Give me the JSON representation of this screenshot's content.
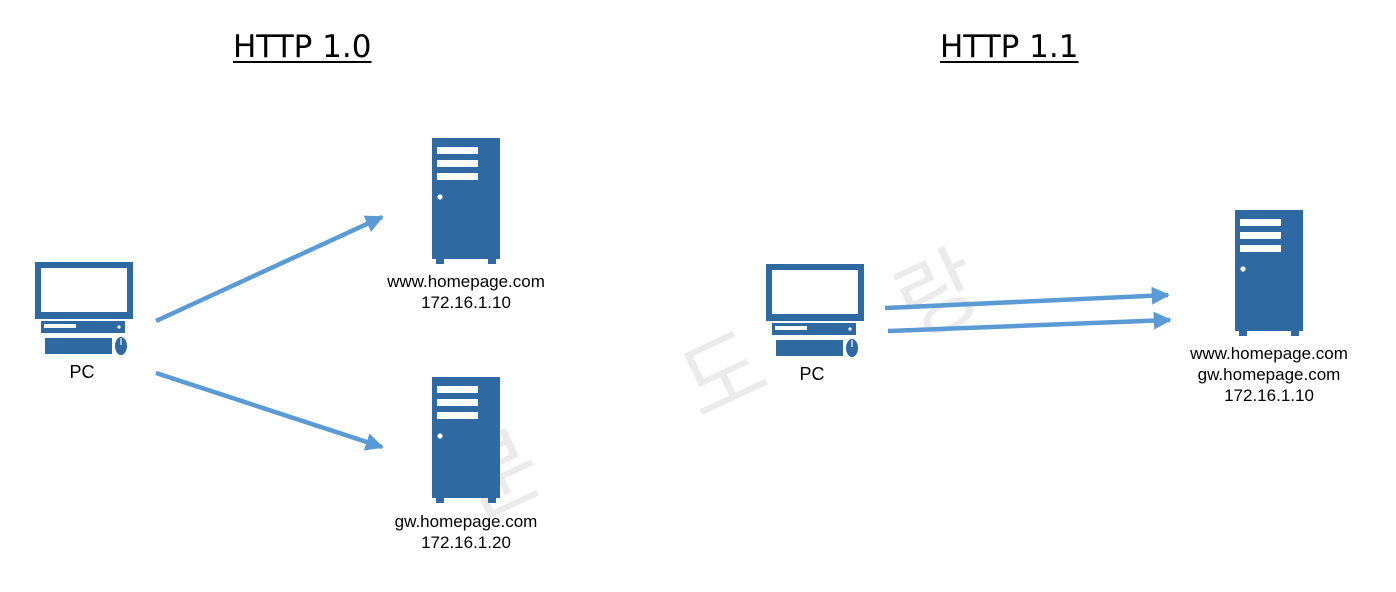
{
  "left_panel": {
    "title": "HTTP 1.0",
    "client": {
      "label": "PC"
    },
    "servers": [
      {
        "host": "www.homepage.com",
        "ip": "172.16.1.10"
      },
      {
        "host": "gw.homepage.com",
        "ip": "172.16.1.20"
      }
    ]
  },
  "right_panel": {
    "title": "HTTP 1.1",
    "client": {
      "label": "PC"
    },
    "server": {
      "hosts": [
        "www.homepage.com",
        "gw.homepage.com"
      ],
      "ip": "172.16.1.10"
    }
  },
  "watermark": [
    "분",
    "도",
    "랑"
  ],
  "colors": {
    "device": "#2e6aa1",
    "arrow": "#5b9bd5",
    "watermark": "#ebebeb"
  }
}
